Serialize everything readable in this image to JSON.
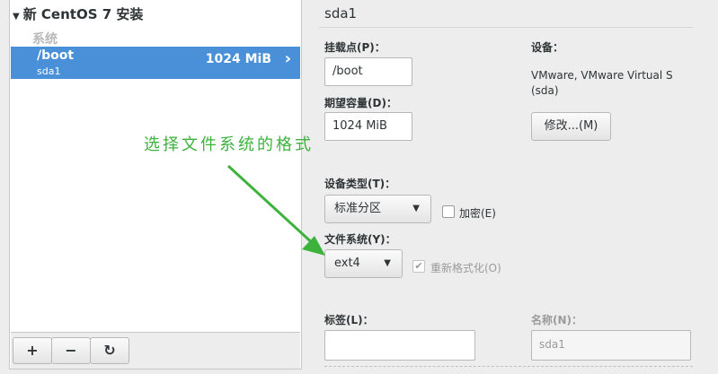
{
  "tree": {
    "header": "新 CentOS 7 安装",
    "group_label": "系统",
    "partition": {
      "name": "/boot",
      "device": "sda1",
      "size": "1024 MiB"
    }
  },
  "toolbar": {
    "add": "+",
    "remove": "−",
    "refresh": "↻"
  },
  "detail": {
    "title": "sda1",
    "mount_label": "挂载点(P)：",
    "mount_value": "/boot",
    "capacity_label": "期望容量(D)：",
    "capacity_value": "1024 MiB",
    "device_label": "设备：",
    "device_line1": "VMware, VMware Virtual S",
    "device_line2": "(sda)",
    "modify_button": "修改...(M)",
    "device_type_label": "设备类型(T)：",
    "device_type_value": "标准分区",
    "encrypt_label": "加密(E)",
    "filesystem_label": "文件系统(Y)：",
    "filesystem_value": "ext4",
    "reformat_label": "重新格式化(O)",
    "reformat_checked": true,
    "tag_label": "标签(L)：",
    "tag_value": "",
    "name_label": "名称(N)：",
    "name_value": "sda1"
  },
  "annotation": {
    "text": "选择文件系统的格式",
    "color": "#3db23d"
  },
  "colors": {
    "selection": "#4a90d9",
    "background": "#ededed"
  }
}
